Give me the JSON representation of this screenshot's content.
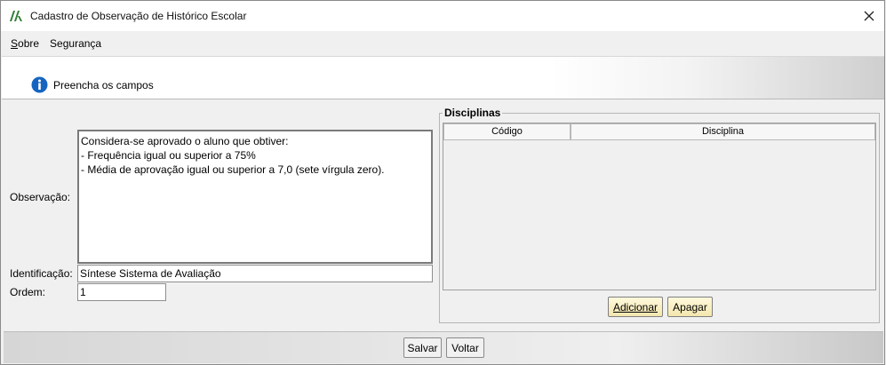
{
  "window": {
    "title": "Cadastro de Observação de Histórico Escolar"
  },
  "menu": {
    "items": [
      "Sobre",
      "Segurança"
    ]
  },
  "header": {
    "info_text": "Preencha os campos"
  },
  "form": {
    "observacao_label": "Observação:",
    "observacao_value": "Considera-se aprovado o aluno que obtiver:\n- Frequência igual ou superior a 75%\n- Média de aprovação igual ou superior a 7,0 (sete vírgula zero).",
    "identificacao_label": "Identificação:",
    "identificacao_value": "Síntese Sistema de Avaliação",
    "ordem_label": "Ordem:",
    "ordem_value": "1"
  },
  "disciplinas": {
    "title": "Disciplinas",
    "columns": [
      "Código",
      "Disciplina"
    ],
    "rows": [],
    "add_label": "Adicionar",
    "delete_label": "Apagar"
  },
  "footer": {
    "save_label": "Salvar",
    "back_label": "Voltar"
  },
  "colors": {
    "info_blue": "#1565c0",
    "button_yellow": "#f4e6ae",
    "logo_green": "#2e7d32"
  }
}
